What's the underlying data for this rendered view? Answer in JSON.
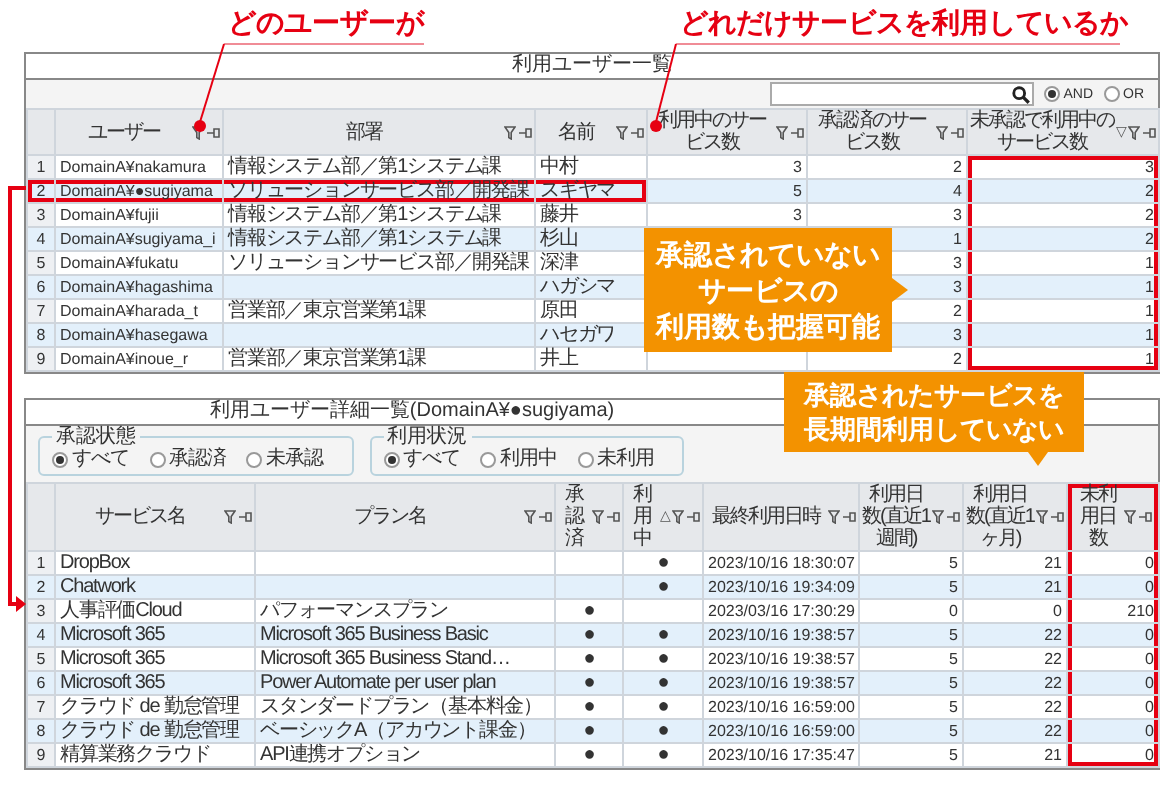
{
  "annotations": {
    "user_label": "どのユーザーが",
    "usage_label": "どれだけサービスを利用しているか"
  },
  "user_list": {
    "title": "利用ユーザー一覧",
    "logic_options": [
      {
        "label": "AND",
        "selected": true
      },
      {
        "label": "OR",
        "selected": false
      }
    ],
    "highlight_header": false,
    "columns": [
      {
        "label": "ユーザー",
        "kind": "id",
        "highlighted": false
      },
      {
        "label": "部署",
        "kind": "text",
        "highlighted": false
      },
      {
        "label": "名前",
        "kind": "text",
        "highlighted": false
      },
      {
        "label": "利用中のサービス数",
        "kind": "number",
        "highlighted": false
      },
      {
        "label": "承認済のサービス数",
        "kind": "number",
        "highlighted": false
      },
      {
        "label": "未承認で利用中のサービス数",
        "kind": "number",
        "highlighted": true,
        "sort": "▽"
      }
    ],
    "rows": [
      {
        "no": "1",
        "highlighted": false,
        "cells": [
          "DomainA¥nakamura",
          "情報システム部／第1システム課",
          "中村",
          "3",
          "2",
          "3"
        ]
      },
      {
        "no": "2",
        "highlighted": true,
        "cells": [
          "DomainA¥●sugiyama",
          "ソリューションサービス部／開発課",
          "スギヤマ",
          "5",
          "4",
          "2"
        ]
      },
      {
        "no": "3",
        "highlighted": false,
        "cells": [
          "DomainA¥fujii",
          "情報システム部／第1システム課",
          "藤井",
          "3",
          "3",
          "2"
        ]
      },
      {
        "no": "4",
        "highlighted": false,
        "cells": [
          "DomainA¥sugiyama_i",
          "情報システム部／第1システム課",
          "杉山",
          null,
          "1",
          "2"
        ]
      },
      {
        "no": "5",
        "highlighted": false,
        "cells": [
          "DomainA¥fukatu",
          "ソリューションサービス部／開発課",
          "深津",
          null,
          "3",
          "1"
        ]
      },
      {
        "no": "6",
        "highlighted": false,
        "cells": [
          "DomainA¥hagashima",
          null,
          "ハガシマ",
          null,
          "3",
          "1"
        ]
      },
      {
        "no": "7",
        "highlighted": false,
        "cells": [
          "DomainA¥harada_t",
          "営業部／東京営業第1課",
          "原田",
          null,
          "2",
          "1"
        ]
      },
      {
        "no": "8",
        "highlighted": false,
        "cells": [
          "DomainA¥hasegawa",
          null,
          "ハセガワ",
          null,
          "3",
          "1"
        ]
      },
      {
        "no": "9",
        "highlighted": false,
        "cells": [
          "DomainA¥inoue_r",
          "営業部／東京営業第1課",
          "井上",
          null,
          "2",
          "1"
        ]
      }
    ]
  },
  "callout_unapproved": {
    "lines": [
      "承認されていない",
      "サービスの",
      "利用数も把握可能"
    ]
  },
  "callout_long_unused": {
    "lines": [
      "承認されたサービスを",
      "長期間利用していない"
    ]
  },
  "detail_list": {
    "title": "利用ユーザー詳細一覧(DomainA¥●sugiyama)",
    "highlight_header": true,
    "filters": [
      {
        "legend": "承認状態",
        "options": [
          {
            "label": "すべて",
            "selected": true
          },
          {
            "label": "承認済",
            "selected": false
          },
          {
            "label": "未承認",
            "selected": false
          }
        ]
      },
      {
        "legend": "利用状況",
        "options": [
          {
            "label": "すべて",
            "selected": true
          },
          {
            "label": "利用中",
            "selected": false
          },
          {
            "label": "未利用",
            "selected": false
          }
        ]
      }
    ],
    "columns": [
      {
        "label": "サービス名",
        "kind": "text",
        "highlighted": false
      },
      {
        "label": "プラン名",
        "kind": "text",
        "highlighted": false
      },
      {
        "label": "承認済",
        "kind": "mark",
        "highlighted": false
      },
      {
        "label": "利用中",
        "kind": "mark",
        "highlighted": false,
        "sort": "△"
      },
      {
        "label": "最終利用日時",
        "kind": "date",
        "highlighted": false
      },
      {
        "label": "利用日数(直近1週間)",
        "kind": "number",
        "highlighted": false
      },
      {
        "label": "利用日数(直近1ヶ月)",
        "kind": "number",
        "highlighted": false
      },
      {
        "label": "未利用日数",
        "kind": "number",
        "highlighted": true
      }
    ],
    "rows": [
      {
        "no": "1",
        "highlighted": false,
        "cells": [
          "DropBox",
          null,
          null,
          "●",
          "2023/10/16 18:30:07",
          "5",
          "21",
          "0"
        ]
      },
      {
        "no": "2",
        "highlighted": false,
        "cells": [
          "Chatwork",
          null,
          null,
          "●",
          "2023/10/16 19:34:09",
          "5",
          "21",
          "0"
        ]
      },
      {
        "no": "3",
        "highlighted": false,
        "cells": [
          "人事評価Cloud",
          "パフォーマンスプラン",
          "●",
          null,
          "2023/03/16 17:30:29",
          "0",
          "0",
          "210"
        ]
      },
      {
        "no": "4",
        "highlighted": false,
        "cells": [
          "Microsoft 365",
          "Microsoft 365 Business Basic",
          "●",
          "●",
          "2023/10/16 19:38:57",
          "5",
          "22",
          "0"
        ]
      },
      {
        "no": "5",
        "highlighted": false,
        "cells": [
          "Microsoft 365",
          "Microsoft 365 Business Stand…",
          "●",
          "●",
          "2023/10/16 19:38:57",
          "5",
          "22",
          "0"
        ]
      },
      {
        "no": "6",
        "highlighted": false,
        "cells": [
          "Microsoft 365",
          "Power Automate per user plan",
          "●",
          "●",
          "2023/10/16 19:38:57",
          "5",
          "22",
          "0"
        ]
      },
      {
        "no": "7",
        "highlighted": false,
        "cells": [
          "クラウド de 勤怠管理",
          "スタンダードプラン（基本料金）",
          "●",
          "●",
          "2023/10/16 16:59:00",
          "5",
          "22",
          "0"
        ]
      },
      {
        "no": "8",
        "highlighted": false,
        "cells": [
          "クラウド de 勤怠管理",
          "ベーシックA（アカウント課金）",
          "●",
          "●",
          "2023/10/16 16:59:00",
          "5",
          "22",
          "0"
        ]
      },
      {
        "no": "9",
        "highlighted": false,
        "cells": [
          "精算業務クラウド",
          "API連携オプション",
          "●",
          "●",
          "2023/10/16 17:35:47",
          "5",
          "21",
          "0"
        ]
      }
    ]
  }
}
